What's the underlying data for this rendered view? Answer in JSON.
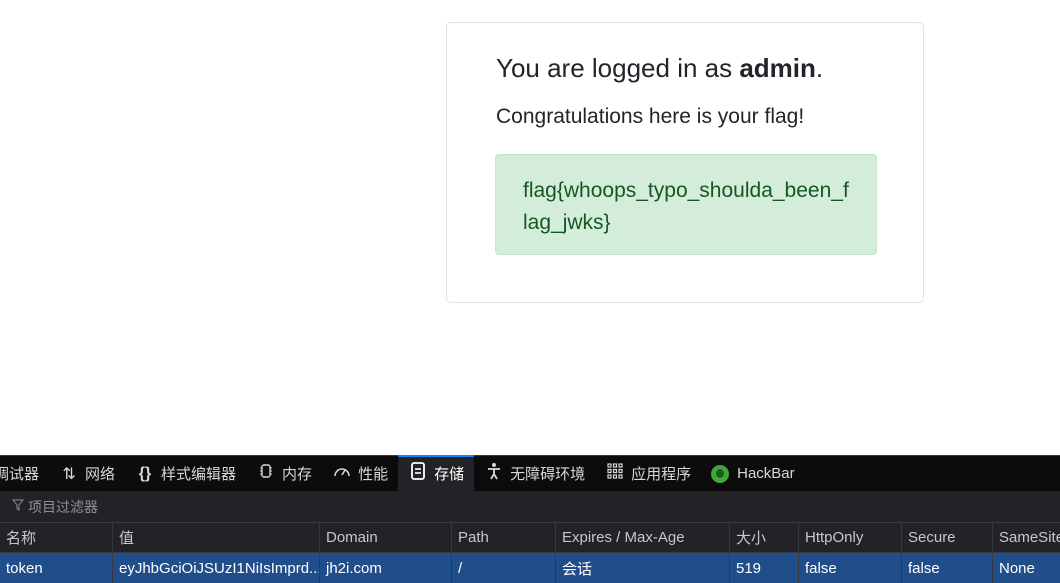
{
  "card": {
    "login_prefix": "You are logged in as ",
    "login_user": "admin",
    "login_suffix": ".",
    "congrats": "Congratulations here is your flag!",
    "flag": "flag{whoops_typo_shoulda_been_flag_jwks}"
  },
  "devtools": {
    "tabs": [
      {
        "label": "调试器",
        "icon": "debugger-icon"
      },
      {
        "label": "网络",
        "icon": "network-arrows-icon"
      },
      {
        "label": "样式编辑器",
        "icon": "braces-icon"
      },
      {
        "label": "内存",
        "icon": "memory-chip-icon"
      },
      {
        "label": "性能",
        "icon": "gauge-icon"
      },
      {
        "label": "存储",
        "icon": "storage-icon"
      },
      {
        "label": "无障碍环境",
        "icon": "accessibility-icon"
      },
      {
        "label": "应用程序",
        "icon": "grid-icon"
      },
      {
        "label": "HackBar",
        "icon": "hackbar-icon"
      }
    ],
    "active_tab": "存储",
    "filter_placeholder": "项目过滤器",
    "columns": [
      "名称",
      "值",
      "Domain",
      "Path",
      "Expires / Max-Age",
      "大小",
      "HttpOnly",
      "Secure",
      "SameSite"
    ],
    "rows": [
      [
        "token",
        "eyJhbGciOiJSUzI1NiIsImprd...",
        "jh2i.com",
        "/",
        "会话",
        "519",
        "false",
        "false",
        "None"
      ]
    ],
    "accent_color": "#0a84ff",
    "selected_row_color": "#204e8a"
  }
}
